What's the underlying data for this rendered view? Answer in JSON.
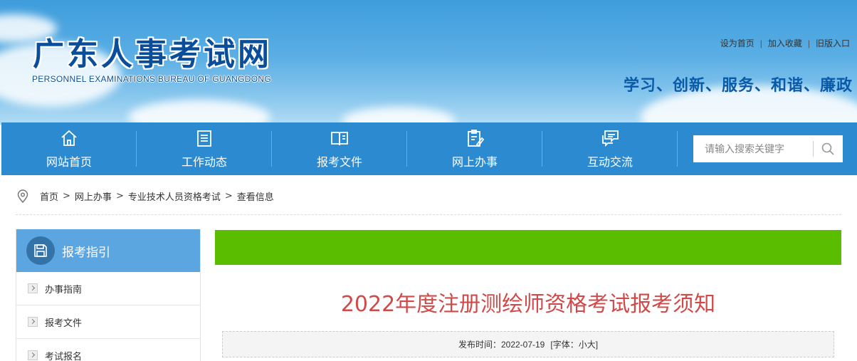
{
  "header": {
    "logo_cn": "广东人事考试网",
    "logo_en": "PERSONNEL EXAMINATIONS BUREAU OF GUANGDONG",
    "links": [
      "设为首页",
      "加入收藏",
      "旧版入口"
    ],
    "slogan": "学习、创新、服务、和谐、廉政"
  },
  "nav": {
    "items": [
      {
        "label": "网站首页",
        "icon": "home-icon"
      },
      {
        "label": "工作动态",
        "icon": "document-list-icon"
      },
      {
        "label": "报考文件",
        "icon": "open-book-icon"
      },
      {
        "label": "网上办事",
        "icon": "clipboard-edit-icon"
      },
      {
        "label": "互动交流",
        "icon": "chat-bubbles-icon"
      }
    ],
    "search_placeholder": "请输入搜索关键字"
  },
  "breadcrumb": [
    "首页",
    "网上办事",
    "专业技术人员资格考试",
    "查看信息"
  ],
  "sidebar": {
    "title": "报考指引",
    "items": [
      "办事指南",
      "报考文件",
      "考试报名"
    ]
  },
  "article": {
    "title": "2022年度注册测绘师资格考试报考须知",
    "published_label": "发布时间：",
    "published_date": "2022-07-19",
    "font_label": "[字体：小大]"
  },
  "colors": {
    "nav_bg": "#2b8ad0",
    "sidebar_head": "#5ba6e0",
    "green_bar": "#5bbd00",
    "title_red": "#d14a4a"
  }
}
